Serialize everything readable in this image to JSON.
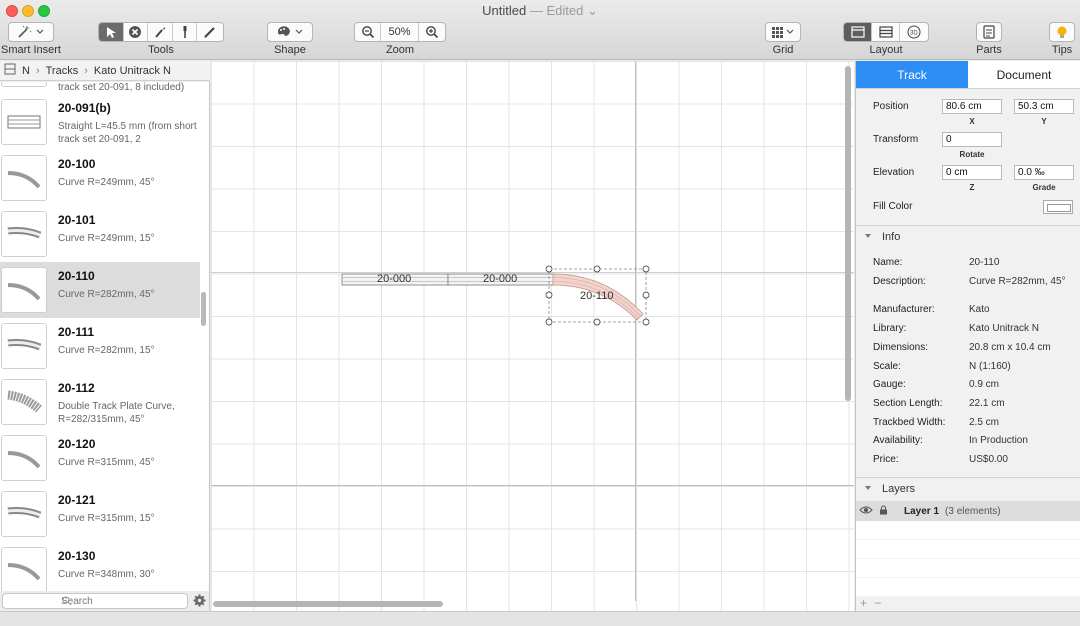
{
  "window": {
    "title": "Untitled",
    "status": "— Edited",
    "status_chevron": "⌄"
  },
  "toolbar": {
    "smart_insert": "Smart Insert",
    "tools": "Tools",
    "shape": "Shape",
    "zoom": "Zoom",
    "zoom_level": "50%",
    "grid": "Grid",
    "layout": "Layout",
    "parts": "Parts",
    "tips": "Tips"
  },
  "breadcrumb": {
    "root": "N",
    "sep": "›",
    "level1": "Tracks",
    "level2": "Kato Unitrack N"
  },
  "parts": [
    {
      "code": "",
      "desc": "track set 20-091, 8 included)",
      "icon": "straight"
    },
    {
      "code": "20-091(b)",
      "desc": "Straight L=45.5 mm  (from short track set 20-091, 2",
      "icon": "straight"
    },
    {
      "code": "20-100",
      "desc": "Curve R=249mm, 45°",
      "icon": "curve45"
    },
    {
      "code": "20-101",
      "desc": "Curve R=249mm, 15°",
      "icon": "curve15"
    },
    {
      "code": "20-110",
      "desc": "Curve R=282mm, 45°",
      "icon": "curve45"
    },
    {
      "code": "20-111",
      "desc": "Curve R=282mm, 15°",
      "icon": "curve15"
    },
    {
      "code": "20-112",
      "desc": "Double Track Plate Curve, R=282/315mm, 45°",
      "icon": "double"
    },
    {
      "code": "20-120",
      "desc": "Curve R=315mm, 45°",
      "icon": "curve45"
    },
    {
      "code": "20-121",
      "desc": "Curve R=315mm, 15°",
      "icon": "curve15"
    },
    {
      "code": "20-130",
      "desc": "Curve R=348mm, 30°",
      "icon": "curve45"
    }
  ],
  "search": {
    "placeholder": "Search"
  },
  "canvas": {
    "track1": "20-000",
    "track2": "20-000",
    "track3": "20-110"
  },
  "inspector": {
    "tab_track": "Track",
    "tab_document": "Document",
    "position_label": "Position",
    "x_value": "80.6 cm",
    "x_label": "X",
    "y_value": "50.3 cm",
    "y_label": "Y",
    "transform_label": "Transform",
    "rotate_value": "0",
    "rotate_label": "Rotate",
    "elevation_label": "Elevation",
    "z_value": "0 cm",
    "z_label": "Z",
    "grade_value": "0.0 ‰",
    "grade_label": "Grade",
    "fill_label": "Fill Color"
  },
  "info": {
    "header": "Info",
    "rows": [
      {
        "k": "Name:",
        "v": "20-110"
      },
      {
        "k": "Description:",
        "v": "Curve R=282mm, 45°"
      },
      {
        "k": "Manufacturer:",
        "v": "Kato"
      },
      {
        "k": "Library:",
        "v": "Kato Unitrack N"
      },
      {
        "k": "Dimensions:",
        "v": "20.8 cm x 10.4 cm"
      },
      {
        "k": "Scale:",
        "v": "N  (1:160)"
      },
      {
        "k": "Gauge:",
        "v": "0.9 cm"
      },
      {
        "k": "Section Length:",
        "v": "22.1 cm"
      },
      {
        "k": "Trackbed Width:",
        "v": "2.5 cm"
      },
      {
        "k": "Availability:",
        "v": "In Production"
      },
      {
        "k": "Price:",
        "v": "US$0.00"
      }
    ]
  },
  "layers": {
    "header": "Layers",
    "layer_name": "Layer 1",
    "layer_count": "(3 elements)"
  },
  "footer": {
    "add": "+",
    "remove": "−"
  },
  "colors": {
    "accent": "#2c8ef5",
    "selection": "#dcdcdc",
    "curve_fill": "#f3d3cc"
  }
}
